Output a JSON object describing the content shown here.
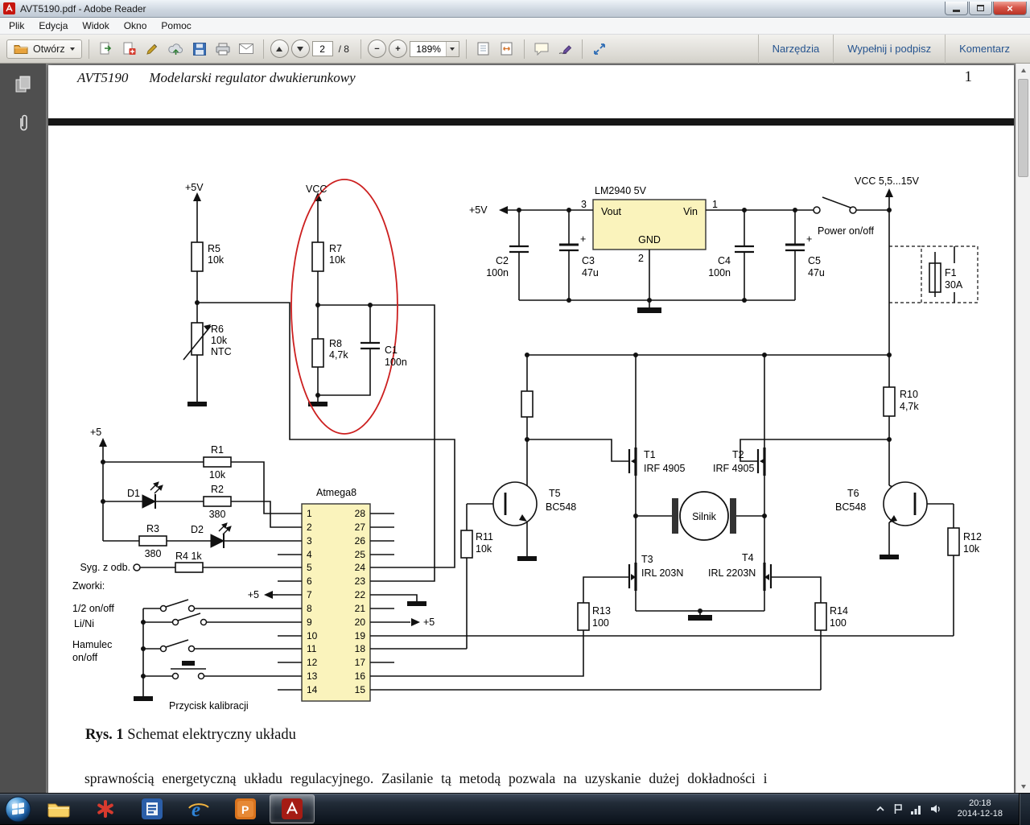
{
  "window": {
    "title": "AVT5190.pdf - Adobe Reader"
  },
  "menu": {
    "items": [
      "Plik",
      "Edycja",
      "Widok",
      "Okno",
      "Pomoc"
    ]
  },
  "toolbar": {
    "open_label": "Otwórz",
    "page_value": "2",
    "page_total": "/ 8",
    "zoom_value": "189%",
    "tools_label": "Narzędzia",
    "fill_sign_label": "Wypełnij i podpisz",
    "comment_label": "Komentarz"
  },
  "document": {
    "header_code": "AVT5190",
    "header_title": "Modelarski regulator dwukierunkowy",
    "page_number": "1",
    "caption_label": "Rys. 1",
    "caption_text": " Schemat elektryczny układu",
    "body_text": "sprawnością energetyczną układu regulacyjnego. Zasilanie tą metodą pozwala na uzyskanie dużej dokładności i"
  },
  "schematic": {
    "plus5v_left": "+5V",
    "r5": "R5",
    "r5_val": "10k",
    "r6": "R6",
    "r6_val": "10k",
    "r6_type": "NTC",
    "vcc": "VCC",
    "r7": "R7",
    "r7_val": "10k",
    "r8": "R8",
    "r8_val": "4,7k",
    "c1": "C1",
    "c1_val": "100n",
    "reg_title": "LM2940 5V",
    "reg_vout": "Vout",
    "reg_vin": "Vin",
    "reg_gnd": "GND",
    "reg_pin3": "3",
    "reg_pin1": "1",
    "reg_pin2": "2",
    "plus5v_reg": "+5V",
    "c2": "C2",
    "c2_val": "100n",
    "c3": "C3",
    "c3_val": "47u",
    "c3_plus": "+",
    "c4": "C4",
    "c4_val": "100n",
    "c5": "C5",
    "c5_val": "47u",
    "c5_plus": "+",
    "power_switch": "Power on/off",
    "vcc_main": "VCC 5,5...15V",
    "f1": "F1",
    "f1_val": "30A",
    "r10": "R10",
    "r10_val": "4,7k",
    "r11": "R11",
    "r11_val": "10k",
    "r12": "R12",
    "r12_val": "10k",
    "r13": "R13",
    "r13_val": "100",
    "r14": "R14",
    "r14_val": "100",
    "t1": "T1",
    "t1_val": "IRF 4905",
    "t2": "T2",
    "t2_val": "IRF 4905",
    "t3": "T3",
    "t3_val": "IRL 203N",
    "t4": "T4",
    "t4_val": "IRL 2203N",
    "t5": "T5",
    "t5_val": "BC548",
    "t6": "T6",
    "t6_val": "BC548",
    "motor": "Silnik",
    "mcu": "Atmega8",
    "plus5_mcu": "+5",
    "plus5_pin7": "+5",
    "plus5_pin20": "+5",
    "r1": "R1",
    "r1_val": "10k",
    "r2": "R2",
    "r2_val": "380",
    "r3": "R3",
    "r3_val": "380",
    "r4": "R4 1k",
    "d1": "D1",
    "d2": "D2",
    "sig_label": "Syg. z odb.",
    "jumpers_label": "Zworki:",
    "half_label": "1/2 on/off",
    "lini_label": "Li/Ni",
    "brake_label1": "Hamulec",
    "brake_label2": "on/off",
    "cal_label": "Przycisk kalibracji",
    "pins_left": [
      "1",
      "2",
      "3",
      "4",
      "5",
      "6",
      "7",
      "8",
      "9",
      "10",
      "11",
      "12",
      "13",
      "14"
    ],
    "pins_right": [
      "28",
      "27",
      "26",
      "25",
      "24",
      "23",
      "22",
      "21",
      "20",
      "19",
      "18",
      "17",
      "16",
      "15"
    ]
  },
  "taskbar": {
    "time": "20:18",
    "date": "2014-12-18"
  }
}
